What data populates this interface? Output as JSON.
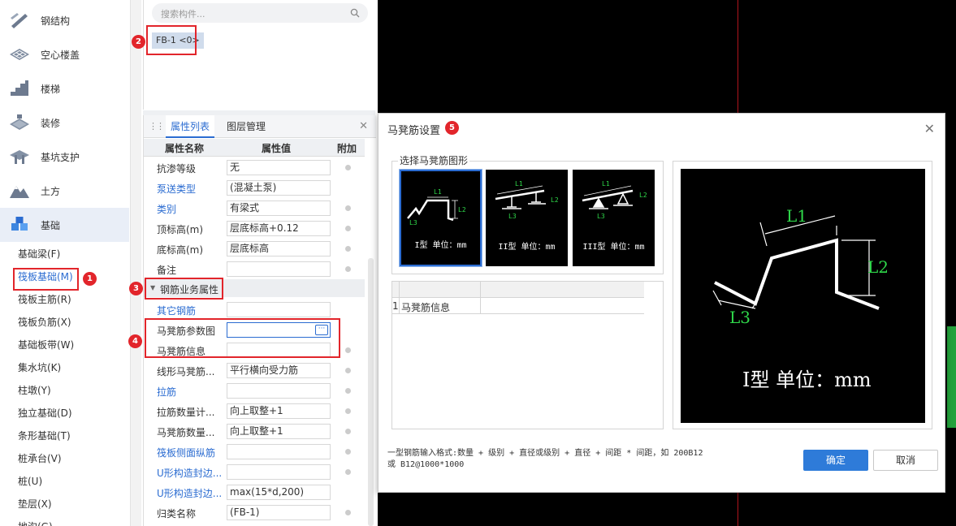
{
  "sidebar": {
    "categories": [
      {
        "label": "钢结构",
        "icon": "steel-structure-icon"
      },
      {
        "label": "空心楼盖",
        "icon": "hollow-floor-icon"
      },
      {
        "label": "楼梯",
        "icon": "stairs-icon"
      },
      {
        "label": "装修",
        "icon": "decoration-icon"
      },
      {
        "label": "基坑支护",
        "icon": "pit-support-icon"
      },
      {
        "label": "土方",
        "icon": "earthwork-icon"
      },
      {
        "label": "基础",
        "icon": "foundation-icon"
      }
    ],
    "sub_items": [
      "基础梁(F)",
      "筏板基础(M)",
      "筏板主筋(R)",
      "筏板负筋(X)",
      "基础板带(W)",
      "集水坑(K)",
      "柱墩(Y)",
      "独立基础(D)",
      "条形基础(T)",
      "桩承台(V)",
      "桩(U)",
      "垫层(X)",
      "地沟(G)"
    ],
    "active_sub_index": 1
  },
  "component_panel": {
    "search_placeholder": "搜索构件...",
    "component_chip": "FB-1 <0>"
  },
  "properties_panel": {
    "tabs": [
      "属性列表",
      "图层管理"
    ],
    "active_tab": 0,
    "columns": {
      "name": "属性名称",
      "value": "属性值",
      "extra": "附加"
    },
    "rows": [
      {
        "name": "抗渗等级",
        "value": "无",
        "link": false,
        "radio": true
      },
      {
        "name": "泵送类型",
        "value": "(混凝土泵)",
        "link": true,
        "radio": false
      },
      {
        "name": "类别",
        "value": "有梁式",
        "link": true,
        "radio": true
      },
      {
        "name": "顶标高(m)",
        "value": "层底标高+0.12",
        "link": false,
        "radio": true
      },
      {
        "name": "底标高(m)",
        "value": "层底标高",
        "link": false,
        "radio": true
      },
      {
        "name": "备注",
        "value": "",
        "link": false,
        "radio": true
      }
    ],
    "group_label": "钢筋业务属性",
    "group_rows": [
      {
        "name": "其它钢筋",
        "value": "",
        "link": true,
        "radio": false
      },
      {
        "name": "马凳筋参数图",
        "value": "",
        "link": false,
        "radio": false,
        "focus": true
      },
      {
        "name": "马凳筋信息",
        "value": "",
        "link": false,
        "radio": true
      },
      {
        "name": "线形马凳筋...",
        "value": "平行横向受力筋",
        "link": false,
        "radio": true
      },
      {
        "name": "拉筋",
        "value": "",
        "link": true,
        "radio": true
      },
      {
        "name": "拉筋数量计...",
        "value": "向上取整+1",
        "link": false,
        "radio": true
      },
      {
        "name": "马凳筋数量...",
        "value": "向上取整+1",
        "link": false,
        "radio": true
      },
      {
        "name": "筏板侧面纵筋",
        "value": "",
        "link": true,
        "radio": true
      },
      {
        "name": "U形构造封边...",
        "value": "",
        "link": true,
        "radio": true
      },
      {
        "name": "U形构造封边...",
        "value": "max(15*d,200)",
        "link": true,
        "radio": false
      },
      {
        "name": "归类名称",
        "value": "(FB-1)",
        "link": false,
        "radio": true
      }
    ]
  },
  "dialog": {
    "title": "马凳筋设置",
    "shape_group_label": "选择马凳筋图形",
    "shape_options": [
      {
        "caption": "I型 单位：mm",
        "labels": [
          "L1",
          "L2",
          "L3"
        ]
      },
      {
        "caption": "II型 单位：mm",
        "labels": [
          "L1",
          "L2",
          "L3"
        ]
      },
      {
        "caption": "III型 单位：mm",
        "labels": [
          "L1",
          "L2",
          "L3"
        ]
      }
    ],
    "selected_shape": 0,
    "table": {
      "row_number": "1",
      "row_label": "马凳筋信息",
      "row_value": ""
    },
    "preview": {
      "labels": [
        "L1",
        "L2",
        "L3"
      ],
      "caption": "I型 单位：mm"
    },
    "hint_line1": "一型钢筋输入格式:数量 + 级别 + 直径或级别 + 直径 + 间距 * 间距，如 200B12",
    "hint_line2": "或 B12@1000*1000",
    "ok_label": "确定",
    "cancel_label": "取消"
  },
  "annotations": [
    "1",
    "2",
    "3",
    "4",
    "5"
  ],
  "colors": {
    "accent": "#2b6cd1",
    "annotation_red": "#e2252b",
    "cad_label_green": "#2fd84a",
    "ok_button": "#2e7bd9"
  }
}
